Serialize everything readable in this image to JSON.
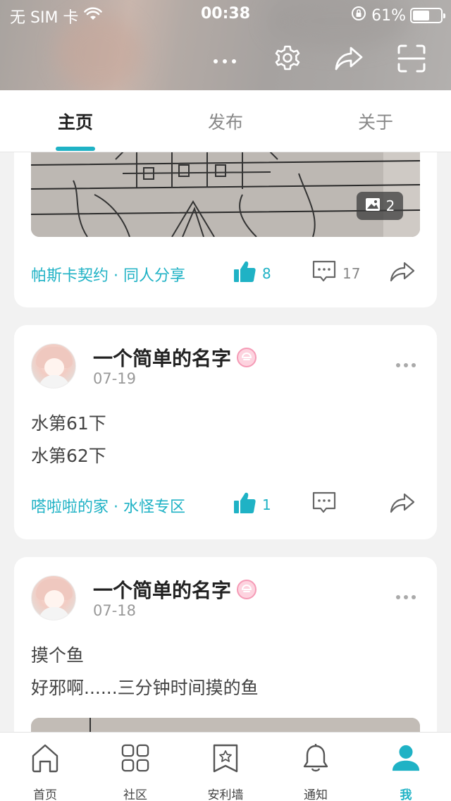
{
  "status_bar": {
    "carrier": "无 SIM 卡",
    "time": "00:38",
    "battery": "61%",
    "battery_level": 0.61
  },
  "header": {
    "icons": [
      "more-icon",
      "settings-icon",
      "share-icon",
      "scan-icon"
    ]
  },
  "tabs": [
    {
      "label": "主页",
      "active": true
    },
    {
      "label": "发布",
      "active": false
    },
    {
      "label": "关于",
      "active": false
    }
  ],
  "posts": [
    {
      "image_count": "2",
      "tags": "帕斯卡契约 · 同人分享",
      "likes": "8",
      "comments": "17"
    },
    {
      "username": "一个简单的名字",
      "date": "07-19",
      "lines": [
        "水第61下",
        "水第62下"
      ],
      "tags": "嗒啦啦的家 · 水怪专区",
      "likes": "1",
      "comments": ""
    },
    {
      "username": "一个简单的名字",
      "date": "07-18",
      "lines": [
        "摸个鱼",
        "好邪啊......三分钟时间摸的鱼"
      ]
    }
  ],
  "bottom_nav": [
    {
      "label": "首页",
      "icon": "home-icon",
      "active": false
    },
    {
      "label": "社区",
      "icon": "grid-icon",
      "active": false
    },
    {
      "label": "安利墙",
      "icon": "star-bookmark-icon",
      "active": false
    },
    {
      "label": "通知",
      "icon": "bell-icon",
      "active": false
    },
    {
      "label": "我",
      "icon": "person-icon",
      "active": true
    }
  ],
  "colors": {
    "accent": "#1fb2c5",
    "background": "#f2f2f2",
    "badge_pink": "#f59bb6"
  }
}
